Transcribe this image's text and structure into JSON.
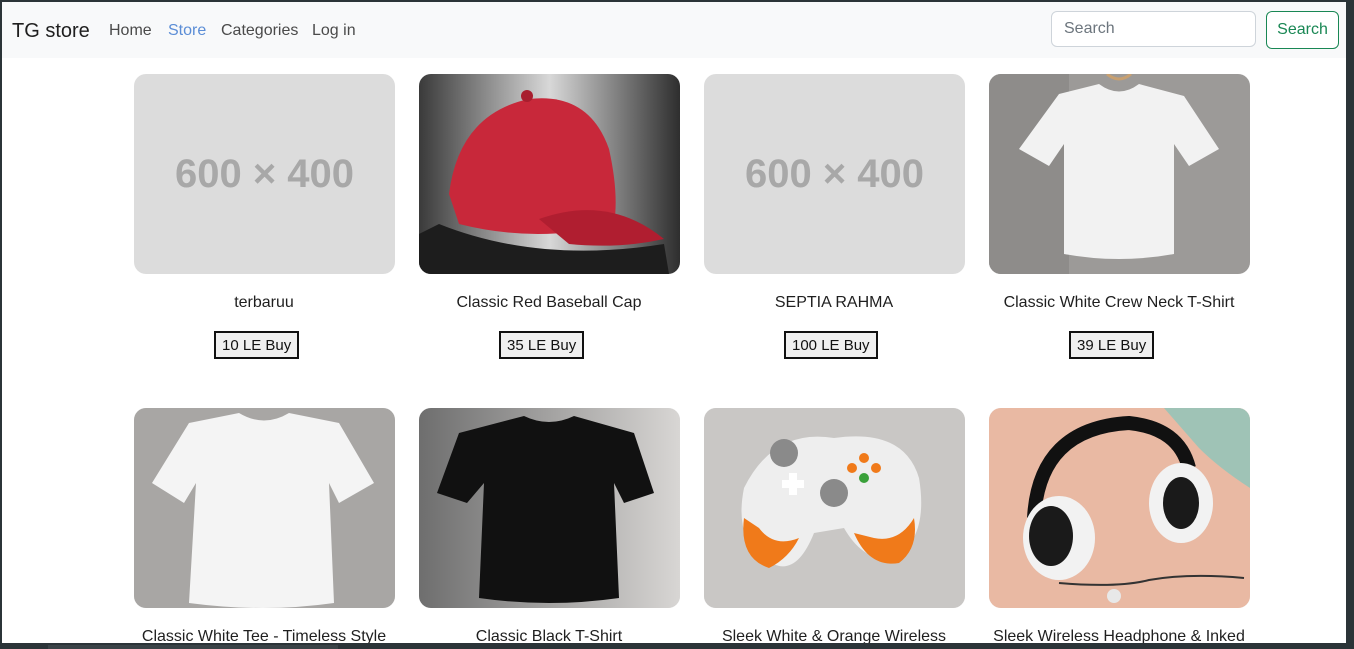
{
  "nav": {
    "brand": "TG store",
    "links": [
      "Home",
      "Store",
      "Categories",
      "Log in"
    ],
    "search_placeholder": "Search",
    "search_button": "Search"
  },
  "products": [
    {
      "name": "terbaruu",
      "price": "10 LE Buy",
      "image": "placeholder",
      "placeholder_text": "600 × 400"
    },
    {
      "name": "Classic Red Baseball Cap",
      "price": "35 LE Buy",
      "image": "red-cap"
    },
    {
      "name": "SEPTIA RAHMA",
      "price": "100 LE Buy",
      "image": "placeholder",
      "placeholder_text": "600 × 400"
    },
    {
      "name": "Classic White Crew Neck T-Shirt",
      "price": "39 LE Buy",
      "image": "white-tshirt-hanger"
    },
    {
      "name": "Classic White Tee - Timeless Style",
      "image": "white-tee"
    },
    {
      "name": "Classic Black T-Shirt",
      "image": "black-tshirt"
    },
    {
      "name": "Sleek White & Orange Wireless",
      "image": "game-controller"
    },
    {
      "name": "Sleek Wireless Headphone & Inked",
      "image": "headphones"
    }
  ],
  "colors": {
    "search_green": "#198754",
    "active_link": "#5b8dd6",
    "navbar_bg": "#f8f9fa"
  }
}
